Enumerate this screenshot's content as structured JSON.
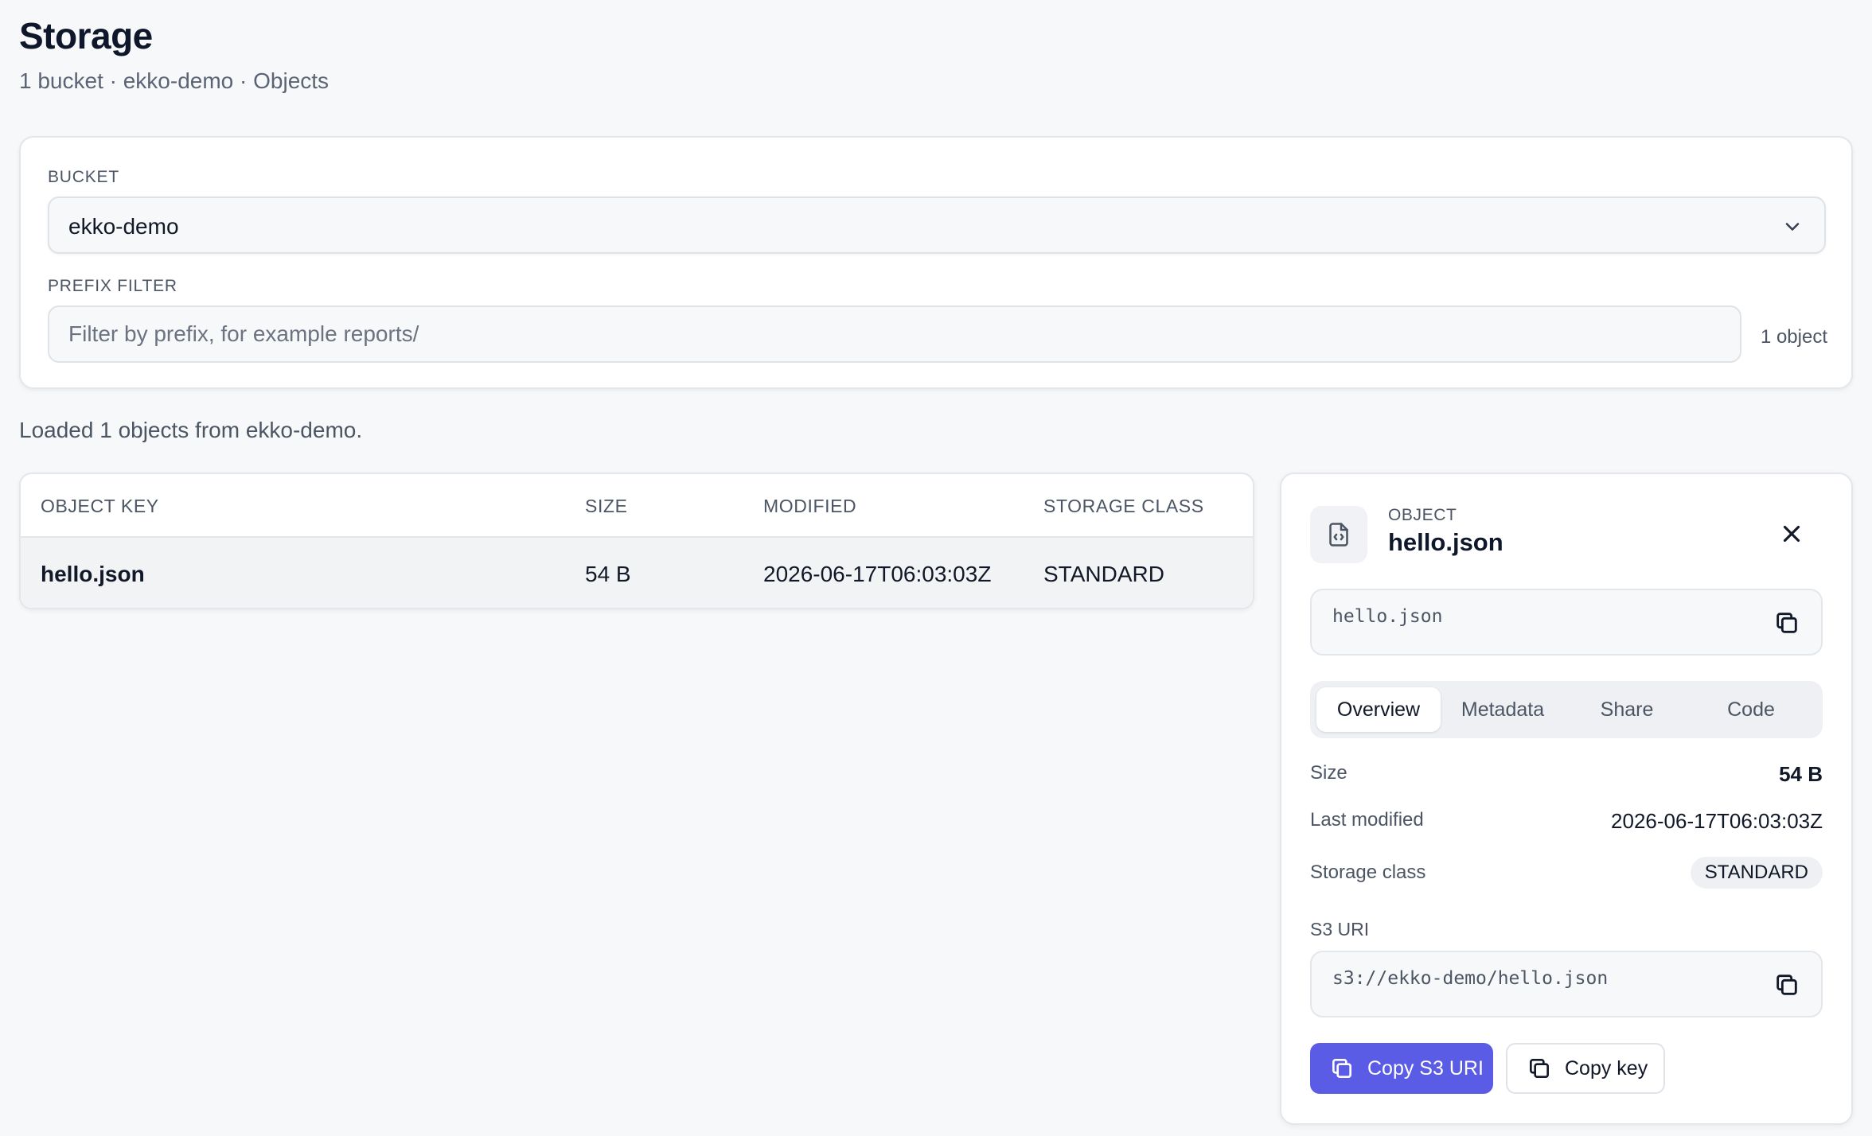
{
  "header": {
    "title": "Storage",
    "subtitle": "1 bucket · ekko-demo · Objects"
  },
  "filters": {
    "bucket_label": "BUCKET",
    "bucket_value": "ekko-demo",
    "prefix_label": "PREFIX FILTER",
    "prefix_placeholder": "Filter by prefix, for example reports/",
    "prefix_value": "",
    "object_count": "1 object"
  },
  "status_message": "Loaded 1 objects from ekko-demo.",
  "table": {
    "columns": [
      "OBJECT KEY",
      "SIZE",
      "MODIFIED",
      "STORAGE CLASS"
    ],
    "rows": [
      {
        "key": "hello.json",
        "size": "54 B",
        "modified": "2026-06-17T06:03:03Z",
        "storage_class": "STANDARD"
      }
    ]
  },
  "detail": {
    "kicker": "OBJECT",
    "title": "hello.json",
    "key_code": "hello.json",
    "tabs": [
      "Overview",
      "Metadata",
      "Share",
      "Code"
    ],
    "active_tab": "Overview",
    "fields": {
      "size_label": "Size",
      "size_value": "54 B",
      "modified_label": "Last modified",
      "modified_value": "2026-06-17T06:03:03Z",
      "class_label": "Storage class",
      "class_value": "STANDARD"
    },
    "uri_label": "S3 URI",
    "uri_value": "s3://ekko-demo/hello.json",
    "copy_uri_label": "Copy S3 URI",
    "copy_key_label": "Copy key"
  },
  "colors": {
    "accent": "#5b5ce6",
    "page_background": "#f7f8fa",
    "selected_row": "#f2f3f5"
  },
  "icons": [
    "chevron-down-icon",
    "file-code-icon",
    "close-icon",
    "copy-icon"
  ]
}
